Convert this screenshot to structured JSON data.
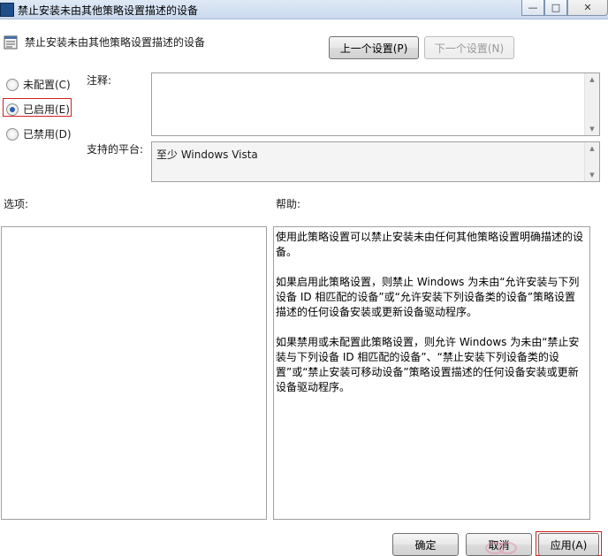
{
  "window": {
    "title": "禁止安装未由其他策略设置描述的设备",
    "minimize_glyph": "—",
    "maximize_glyph": "□",
    "close_glyph": "✕"
  },
  "header": {
    "policy_title": "禁止安装未由其他策略设置描述的设备",
    "prev_button": "上一个设置(P)",
    "next_button": "下一个设置(N)"
  },
  "state": {
    "options": [
      {
        "label": "未配置(C)",
        "checked": false
      },
      {
        "label": "已启用(E)",
        "checked": true
      },
      {
        "label": "已禁用(D)",
        "checked": false
      }
    ]
  },
  "comment": {
    "label": "注释:",
    "value": ""
  },
  "platform": {
    "label": "支持的平台:",
    "value": "至少 Windows Vista"
  },
  "options_panel": {
    "label": "选项:"
  },
  "help_panel": {
    "label": "帮助:",
    "paragraphs": [
      "使用此策略设置可以禁止安装未由任何其他策略设置明确描述的设备。",
      "如果启用此策略设置，则禁止 Windows 为未由“允许安装与下列设备 ID 相匹配的设备”或“允许安装下列设备类的设备”策略设置描述的任何设备安装或更新设备驱动程序。",
      "如果禁用或未配置此策略设置，则允许 Windows 为未由“禁止安装与下列设备 ID 相匹配的设备”、“禁止安装下列设备类的设置”或“禁止安装可移动设备”策略设置描述的任何设备安装或更新设备驱动程序。"
    ]
  },
  "footer": {
    "ok_button": "确定",
    "cancel_button": "取消",
    "apply_button": "应用(A)"
  },
  "colors": {
    "highlight_border": "#d32020",
    "radio_dot": "#2a5ea8"
  }
}
